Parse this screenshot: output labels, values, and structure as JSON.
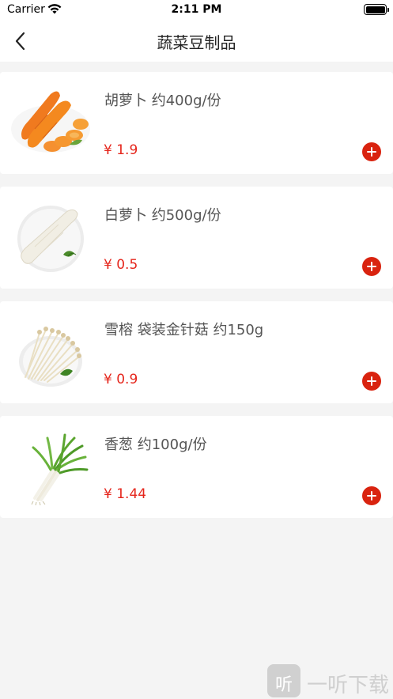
{
  "status_bar": {
    "carrier": "Carrier",
    "time": "2:11 PM"
  },
  "nav": {
    "title": "蔬菜豆制品",
    "back_icon": "chevron-left-icon"
  },
  "products": [
    {
      "name": "胡萝卜 约400g/份",
      "price": "¥ 1.9",
      "image": "carrot-image"
    },
    {
      "name": "白萝卜 约500g/份",
      "price": "¥ 0.5",
      "image": "white-radish-image"
    },
    {
      "name": "雪榕 袋装金针菇 约150g",
      "price": "¥ 0.9",
      "image": "enoki-mushroom-image"
    },
    {
      "name": "香葱 约100g/份",
      "price": "¥ 1.44",
      "image": "scallion-image"
    }
  ],
  "colors": {
    "accent": "#d9230f",
    "price": "#e5261c",
    "background": "#f4f4f4"
  },
  "watermark": {
    "badge": "听",
    "text": "一听下载"
  }
}
